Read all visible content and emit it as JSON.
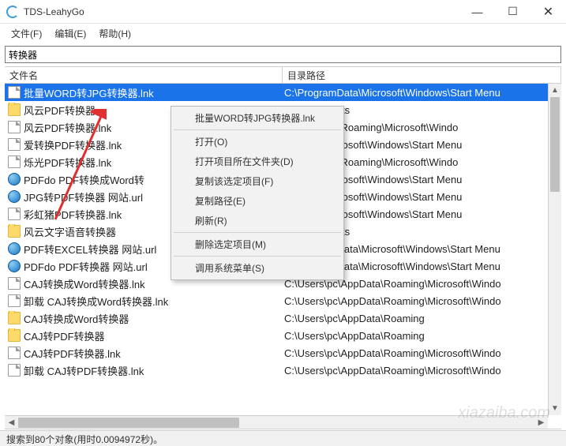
{
  "window": {
    "title": "TDS-LeahyGo",
    "min": "—",
    "max": "☐",
    "close": "✕"
  },
  "menus": {
    "file": "文件(F)",
    "edit": "编辑(E)",
    "help": "帮助(H)"
  },
  "search": {
    "value": "转换器"
  },
  "columns": {
    "name": "文件名",
    "path": "目录路径"
  },
  "rows": [
    {
      "icon": "file",
      "name": "批量WORD转JPG转换器.lnk",
      "path": "C:\\ProgramData\\Microsoft\\Windows\\Start Menu",
      "sel": true
    },
    {
      "icon": "folder",
      "name": "风云PDF转换器",
      "path": "pc\\Documents"
    },
    {
      "icon": "file",
      "name": "风云PDF转换器.lnk",
      "path": "pc\\AppData\\Roaming\\Microsoft\\Windo"
    },
    {
      "icon": "file",
      "name": "爱转换PDF转换器.lnk",
      "path": "amData\\Microsoft\\Windows\\Start Menu"
    },
    {
      "icon": "file",
      "name": "烁光PDF转换器.lnk",
      "path": "pc\\AppData\\Roaming\\Microsoft\\Windo"
    },
    {
      "icon": "globe",
      "name": "PDFdo PDF转换成Word转",
      "path": "amData\\Microsoft\\Windows\\Start Menu"
    },
    {
      "icon": "globe",
      "name": "JPG转PDF转换器 网站.url",
      "path": "amData\\Microsoft\\Windows\\Start Menu"
    },
    {
      "icon": "file",
      "name": "彩虹猪PDF转换器.lnk",
      "path": "amData\\Microsoft\\Windows\\Start Menu"
    },
    {
      "icon": "folder",
      "name": "风云文字语音转换器",
      "path": "pc\\Documents"
    },
    {
      "icon": "globe",
      "name": "PDF转EXCEL转换器 网站.url",
      "path": "C:\\ProgramData\\Microsoft\\Windows\\Start Menu"
    },
    {
      "icon": "globe",
      "name": "PDFdo PDF转换器 网站.url",
      "path": "C:\\ProgramData\\Microsoft\\Windows\\Start Menu"
    },
    {
      "icon": "file",
      "name": "CAJ转换成Word转换器.lnk",
      "path": "C:\\Users\\pc\\AppData\\Roaming\\Microsoft\\Windo"
    },
    {
      "icon": "file",
      "name": "卸载 CAJ转换成Word转换器.lnk",
      "path": "C:\\Users\\pc\\AppData\\Roaming\\Microsoft\\Windo"
    },
    {
      "icon": "folder",
      "name": "CAJ转换成Word转换器",
      "path": "C:\\Users\\pc\\AppData\\Roaming"
    },
    {
      "icon": "folder",
      "name": "CAJ转PDF转换器",
      "path": "C:\\Users\\pc\\AppData\\Roaming"
    },
    {
      "icon": "file",
      "name": "CAJ转PDF转换器.lnk",
      "path": "C:\\Users\\pc\\AppData\\Roaming\\Microsoft\\Windo"
    },
    {
      "icon": "file",
      "name": "卸载 CAJ转PDF转换器.lnk",
      "path": "C:\\Users\\pc\\AppData\\Roaming\\Microsoft\\Windo"
    }
  ],
  "context": {
    "title": "批量WORD转JPG转换器.lnk",
    "open": "打开(O)",
    "openFolder": "打开项目所在文件夹(D)",
    "copyItem": "复制该选定项目(F)",
    "copyPath": "复制路径(E)",
    "refresh": "刷新(R)",
    "delete": "删除选定项目(M)",
    "sysmenu": "调用系统菜单(S)"
  },
  "status": "搜索到80个对象(用时0.0094972秒)。",
  "watermark": "xiazaiba.com"
}
